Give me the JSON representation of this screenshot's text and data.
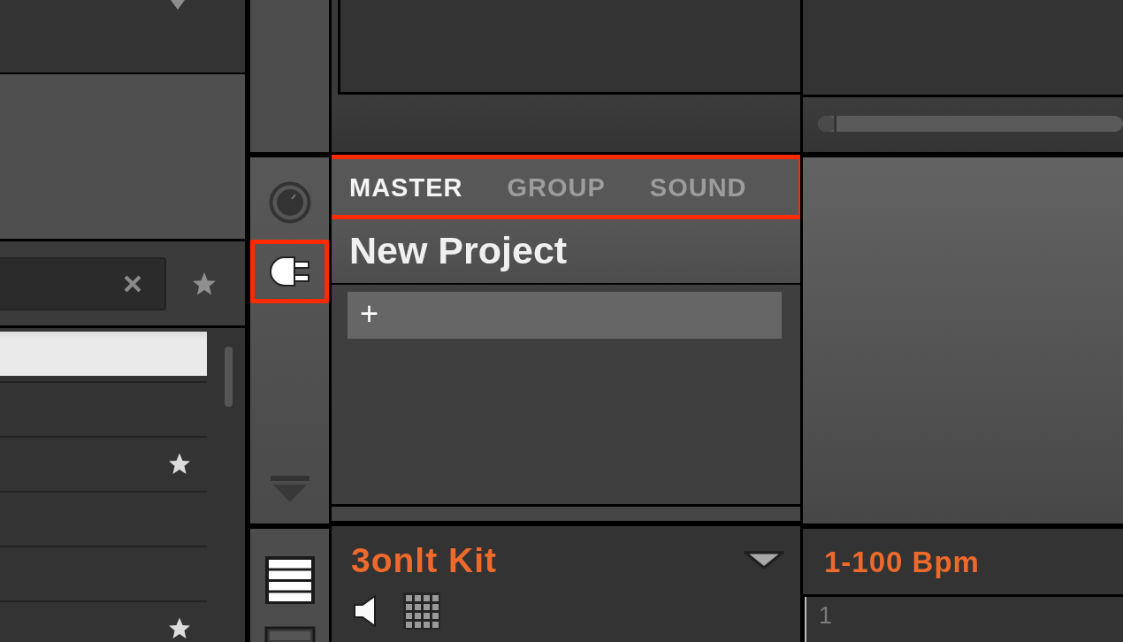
{
  "browser": {
    "favorites_filter": {
      "on": false
    },
    "rows": [
      {
        "selected": true,
        "favorite": false
      },
      {
        "selected": false,
        "favorite": false
      },
      {
        "selected": false,
        "favorite": true
      },
      {
        "selected": false,
        "favorite": false
      },
      {
        "selected": false,
        "favorite": false
      },
      {
        "selected": false,
        "favorite": true
      }
    ]
  },
  "side_icons": [
    {
      "kind": "knob",
      "selected": false,
      "highlighted": false
    },
    {
      "kind": "plug",
      "selected": true,
      "highlighted": true
    }
  ],
  "header_tabs": {
    "highlighted": true,
    "tabs": [
      {
        "label": "MASTER",
        "selected": true
      },
      {
        "label": "GROUP",
        "selected": false
      },
      {
        "label": "SOUND",
        "selected": false
      }
    ]
  },
  "project": {
    "name": "New Project"
  },
  "slots": {
    "add_label": "+"
  },
  "group": {
    "name": "3onlt Kit"
  },
  "view_icons": [
    {
      "kind": "list",
      "selected": true
    },
    {
      "kind": "panel",
      "selected": false
    }
  ],
  "tempo": {
    "label": "1-100 Bpm"
  },
  "timeline": {
    "marker": "1"
  }
}
